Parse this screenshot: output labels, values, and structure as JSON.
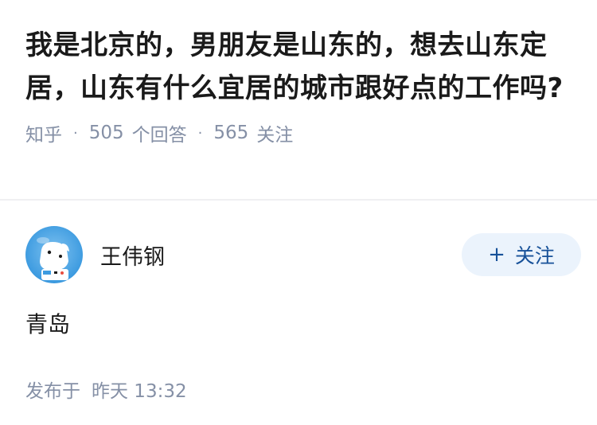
{
  "question": {
    "title": "我是北京的，男朋友是山东的，想去山东定居，山东有什么宜居的城市跟好点的工作吗?",
    "source": "知乎",
    "separator": "·",
    "answer_count": "505",
    "answer_label": "个回答",
    "follower_count": "565",
    "follower_label": "关注"
  },
  "answer": {
    "author_name": "王伟钢",
    "follow_button": {
      "plus": "+",
      "label": "关注"
    },
    "content": "青岛",
    "published_label": "发布于",
    "published_time": "昨天 13:32"
  },
  "colors": {
    "meta_gray": "#8590a6",
    "follow_bg": "#ebf3fc",
    "follow_text": "#175199",
    "avatar_blue": "#3d9be0"
  }
}
